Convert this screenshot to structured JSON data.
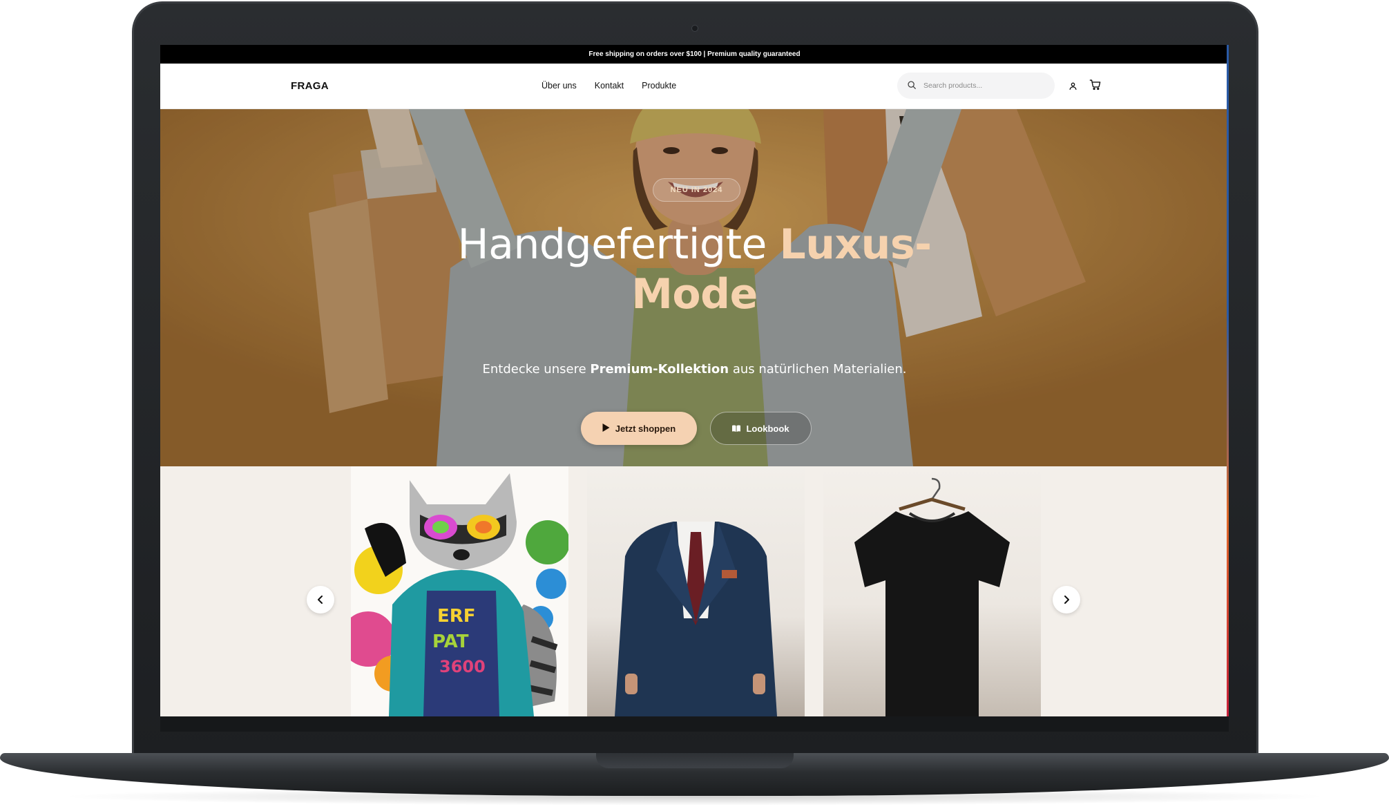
{
  "promo": {
    "text": "Free shipping on orders over $100 | Premium quality guaranteed"
  },
  "header": {
    "brand": "FRAGA",
    "nav": {
      "about": "Über uns",
      "contact": "Kontakt",
      "products": "Produkte"
    },
    "search_placeholder": "Search products..."
  },
  "hero": {
    "badge": "NEU IN 2024",
    "title_regular": "Handgefertigte ",
    "title_accent_1": "Luxus-",
    "title_accent_2": "Mode",
    "subtitle_pre": "Entdecke unsere ",
    "subtitle_bold": "Premium-Kollektion",
    "subtitle_post": " aus natürlichen Materialien.",
    "primary_button": "Jetzt shoppen",
    "secondary_button": "Lookbook"
  },
  "colors": {
    "accent": "#f5d2b2",
    "promo_bg": "#000000",
    "carousel_bg": "#f3efea"
  },
  "icons": {
    "search": "search-icon",
    "user": "user-icon",
    "cart": "cart-icon",
    "play": "play-icon",
    "book": "book-open-icon",
    "prev": "chevron-left-icon",
    "next": "chevron-right-icon"
  }
}
